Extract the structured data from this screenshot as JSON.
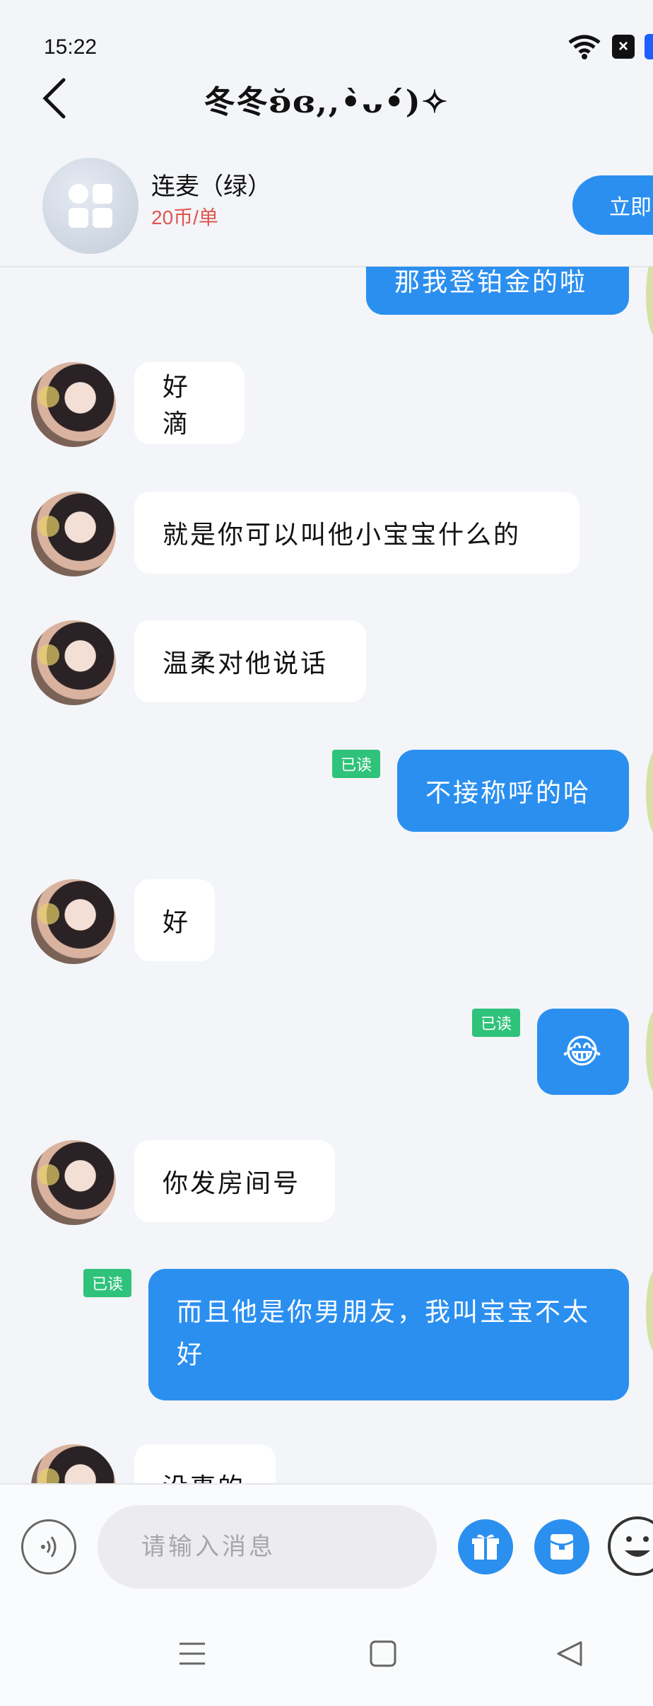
{
  "status_bar": {
    "time": "15:22"
  },
  "header": {
    "title": "冬冬ʚ̆ɞ,,•̀ᴗ•́)✧"
  },
  "service": {
    "name": "连麦（绿）",
    "price": "20币/单",
    "order_button": "立即"
  },
  "messages": [
    {
      "from": "me",
      "text": "那我登铂金的啦",
      "read": ""
    },
    {
      "from": "other",
      "text": "好滴"
    },
    {
      "from": "other",
      "text": "就是你可以叫他小宝宝什么的"
    },
    {
      "from": "other",
      "text": "温柔对他说话"
    },
    {
      "from": "me",
      "text": "不接称呼的哈",
      "read": "已读"
    },
    {
      "from": "other",
      "text": "好"
    },
    {
      "from": "me",
      "text": "😂",
      "read": "已读"
    },
    {
      "from": "other",
      "text": "你发房间号"
    },
    {
      "from": "me",
      "text": "而且他是你男朋友，我叫宝宝不太好",
      "read": "已读"
    },
    {
      "from": "other",
      "text": "没事的"
    }
  ],
  "input": {
    "placeholder": "请输入消息"
  },
  "icons": {
    "back": "chevron-left-icon",
    "voice": "voice-icon",
    "gift": "gift-icon",
    "red_packet": "red-packet-icon",
    "emoji": "emoji-icon",
    "nav_menu": "menu-icon",
    "nav_home": "home-icon",
    "nav_back": "back-triangle-icon"
  },
  "colors": {
    "accent": "#2b8ff0",
    "read_badge": "#2fc27a",
    "price": "#e0554f"
  }
}
